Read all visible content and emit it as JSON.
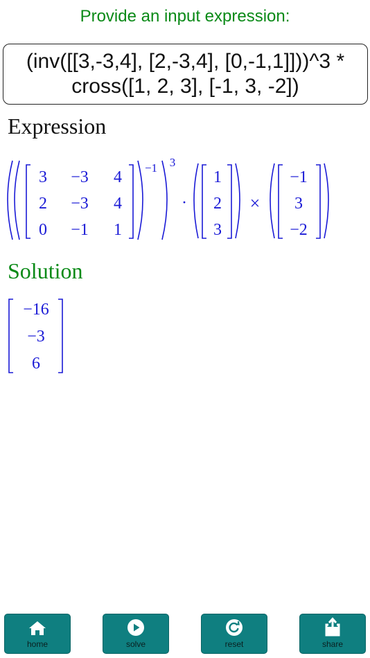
{
  "prompt": "Provide an input expression:",
  "input": {
    "line1": "(inv([[3,-3,4], [2,-3,4], [0,-1,1]]))^3 *",
    "line2": "cross([1, 2, 3], [-1, 3, -2])"
  },
  "expression": {
    "title": "Expression",
    "matrix": [
      [
        "3",
        "−3",
        "4"
      ],
      [
        "2",
        "−3",
        "4"
      ],
      [
        "0",
        "−1",
        "1"
      ]
    ],
    "inverse_exp": "−1",
    "power_exp": "3",
    "dot": "·",
    "cross": "×",
    "vector_a": [
      "1",
      "2",
      "3"
    ],
    "vector_b": [
      "−1",
      "3",
      "−2"
    ]
  },
  "solution": {
    "title": "Solution",
    "vector": [
      "−16",
      "−3",
      "6"
    ]
  },
  "toolbar": {
    "home": "home",
    "solve": "solve",
    "reset": "reset",
    "share": "share"
  },
  "colors": {
    "accent_green": "#0a8a17",
    "math_blue": "#1a1ad6",
    "toolbar_teal": "#0f7f80"
  },
  "icons": {
    "home": "home-icon",
    "solve": "play-icon",
    "reset": "reset-icon",
    "share": "share-icon"
  }
}
